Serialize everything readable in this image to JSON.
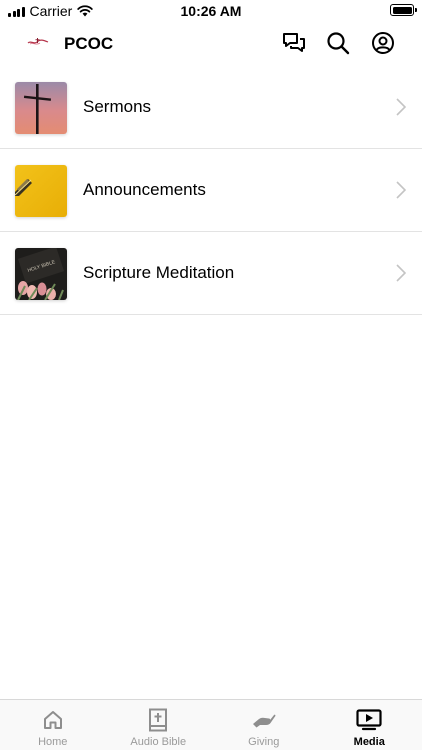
{
  "status_bar": {
    "carrier": "Carrier",
    "time": "10:26 AM"
  },
  "header": {
    "title": "PCOC",
    "logo_icon": "church-logo-icon",
    "actions": [
      {
        "name": "chat",
        "icon": "chat-bubbles-icon"
      },
      {
        "name": "search",
        "icon": "search-icon"
      },
      {
        "name": "profile",
        "icon": "profile-icon"
      }
    ]
  },
  "media_list": [
    {
      "label": "Sermons",
      "thumbnail": "cross-sunset-thumbnail"
    },
    {
      "label": "Announcements",
      "thumbnail": "yellow-pencil-thumbnail"
    },
    {
      "label": "Scripture Meditation",
      "thumbnail": "holy-bible-tulips-thumbnail"
    }
  ],
  "tab_bar": {
    "tabs": [
      {
        "label": "Home",
        "icon": "home-icon",
        "active": false
      },
      {
        "label": "Audio Bible",
        "icon": "bible-icon",
        "active": false
      },
      {
        "label": "Giving",
        "icon": "giving-hand-icon",
        "active": false
      },
      {
        "label": "Media",
        "icon": "media-play-icon",
        "active": true
      }
    ]
  },
  "colors": {
    "active_tab": "#000000",
    "inactive_tab": "#9a9a9a",
    "divider": "#e3e3e3",
    "chevron": "#c4c4c4"
  }
}
